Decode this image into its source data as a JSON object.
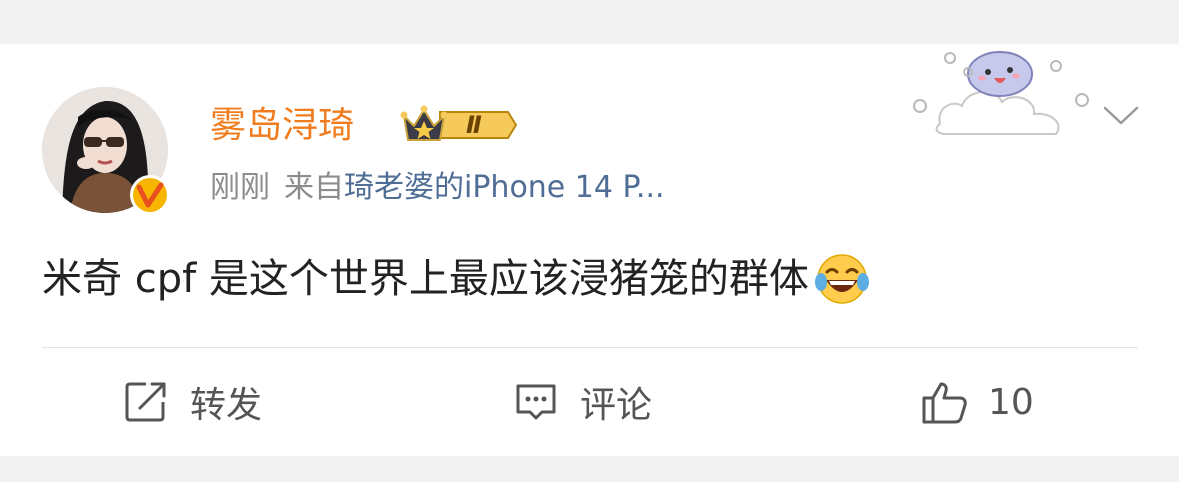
{
  "post": {
    "username": "雾岛浔琦",
    "vip_level": "Ⅱ",
    "time": "刚刚",
    "source_prefix": "来自",
    "device": "琦老婆的iPhone 14 P...",
    "content": "米奇 cpf 是这个世界上最应该浸猪笼的群体"
  },
  "actions": {
    "repost_label": "转发",
    "comment_label": "评论",
    "like_count": "10"
  },
  "icons": {
    "avatar": "avatar-photo",
    "verified": "verified-v-badge-icon",
    "vip": "crown-vip-badge-icon",
    "sticker": "cartoon-sticker-icon",
    "menu": "chevron-down-icon",
    "emoji": "laugh-cry-emoji-icon",
    "repost": "repost-icon",
    "comment": "comment-icon",
    "like": "thumbs-up-icon"
  },
  "colors": {
    "username": "#f07c1e",
    "device": "#4f6d95",
    "meta": "#8c8c8c",
    "text": "#222222",
    "action": "#555555",
    "background": "#f2f2f2"
  }
}
